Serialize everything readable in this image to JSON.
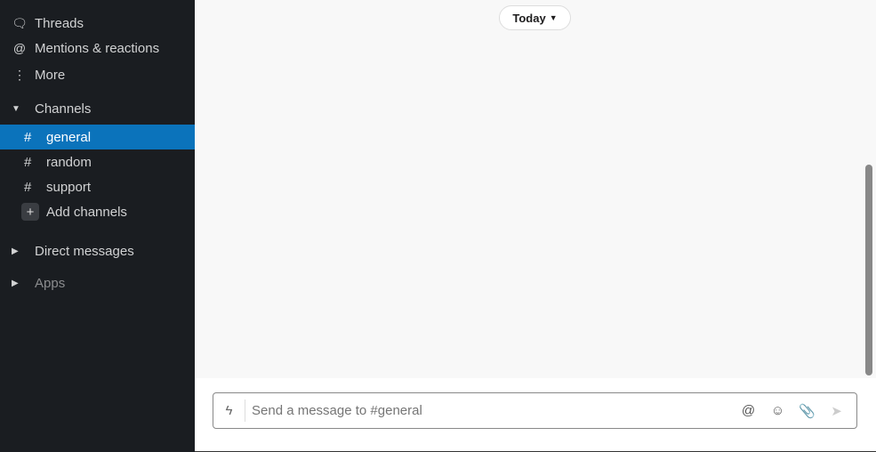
{
  "sidebar": {
    "nav": [
      {
        "label": "Threads",
        "icon": "threads-icon"
      },
      {
        "label": "Mentions & reactions",
        "icon": "at-icon"
      },
      {
        "label": "More",
        "icon": "more-icon"
      }
    ],
    "channels_header": "Channels",
    "channels": [
      {
        "name": "general",
        "selected": true
      },
      {
        "name": "random"
      },
      {
        "name": "support"
      }
    ],
    "add_channels": "Add channels",
    "direct_messages": "Direct messages",
    "apps": "Apps"
  },
  "main": {
    "date_divider": "Today",
    "composer": {
      "placeholder": "Send a message to #general"
    }
  },
  "colors": {
    "sidebar_bg": "#1a1d21",
    "selected": "#0b73bb"
  }
}
